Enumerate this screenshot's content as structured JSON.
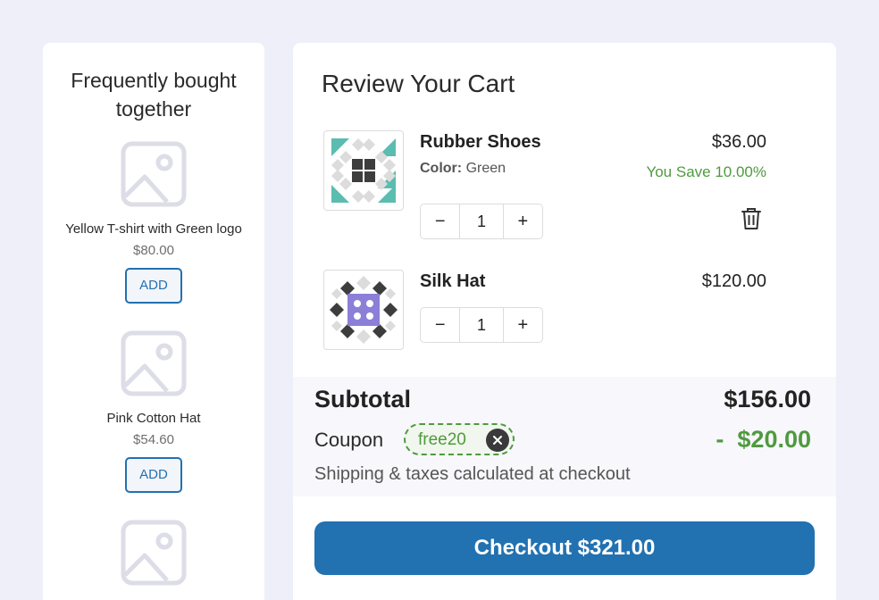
{
  "sidebar": {
    "title": "Frequently bought together",
    "items": [
      {
        "name": "Yellow T-shirt with Green logo",
        "price": "$80.00",
        "button": "ADD"
      },
      {
        "name": "Pink Cotton Hat",
        "price": "$54.60",
        "button": "ADD"
      },
      {
        "name": "",
        "price": "",
        "button": ""
      }
    ],
    "placeholder_icon": "image-placeholder-icon"
  },
  "cart": {
    "title": "Review Your Cart",
    "items": [
      {
        "name": "Rubber Shoes",
        "meta_label": "Color:",
        "meta_value": "Green",
        "price": "$36.00",
        "savings": "You Save 10.00%",
        "quantity": "1",
        "has_delete": true,
        "thumb_colors": [
          "#5bbcb0",
          "#3d3d3d",
          "#dcdcdc"
        ]
      },
      {
        "name": "Silk Hat",
        "price": "$120.00",
        "quantity": "1",
        "thumb_colors": [
          "#8b7fd8",
          "#3d3d3d",
          "#dcdcdc"
        ]
      }
    ],
    "summary": {
      "subtotal_label": "Subtotal",
      "subtotal_value": "$156.00",
      "coupon_label": "Coupon",
      "coupon_code": "free20",
      "coupon_discount": "-  $20.00",
      "shipping_note": "Shipping & taxes calculated at checkout"
    },
    "checkout_label": "Checkout $321.00"
  },
  "colors": {
    "accent": "#2271b1",
    "success": "#4f9a3e",
    "background": "#eeeff8"
  }
}
